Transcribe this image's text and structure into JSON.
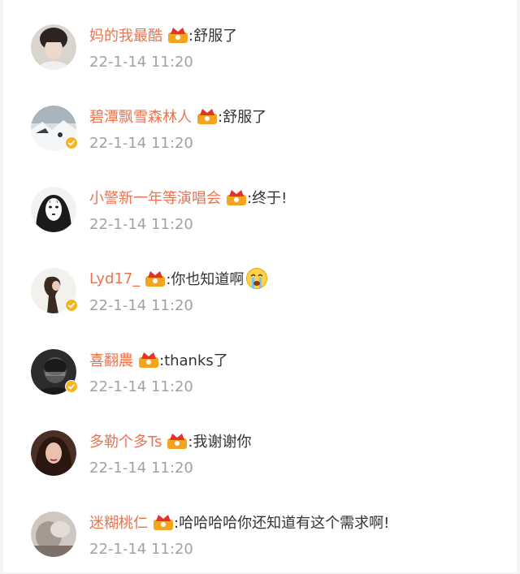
{
  "comments": [
    {
      "username": "妈的我最酷",
      "text": ":舒服了",
      "time": "22-1-14 11:20",
      "avatar_icon": "avatar-boy-portrait",
      "verified": false
    },
    {
      "username": "碧潭飘雪森林人",
      "text": ":舒服了",
      "time": "22-1-14 11:20",
      "avatar_icon": "avatar-snow-landscape",
      "verified": true
    },
    {
      "username": "小警新一年等演唱会",
      "text": ":终于!",
      "time": "22-1-14 11:20",
      "avatar_icon": "avatar-no-face-mask",
      "verified": false
    },
    {
      "username": "Lyd17_",
      "text": ":你也知道啊",
      "time": "22-1-14 11:20",
      "avatar_icon": "avatar-girl-silhouette",
      "verified": true,
      "emoji_icon": "crying-face-emoji"
    },
    {
      "username": "喜翻農",
      "text": ":thanks了",
      "time": "22-1-14 11:20",
      "avatar_icon": "avatar-dark-portrait",
      "verified": true
    },
    {
      "username": "多勒个多Ts",
      "text": ":我谢谢你",
      "time": "22-1-14 11:20",
      "avatar_icon": "avatar-woman-portrait",
      "verified": false
    },
    {
      "username": "迷糊桃仁",
      "text": ":哈哈哈哈你还知道有这个需求啊!",
      "time": "22-1-14 11:20",
      "avatar_icon": "avatar-blurred-photo",
      "verified": false
    }
  ],
  "colors": {
    "username": "#eb7350",
    "text": "#333333",
    "timestamp": "#a2a2a2",
    "verified_badge": "#f5b521",
    "crown_badge": "#f3a520"
  },
  "badge_icon": "crown-fan-badge-icon"
}
